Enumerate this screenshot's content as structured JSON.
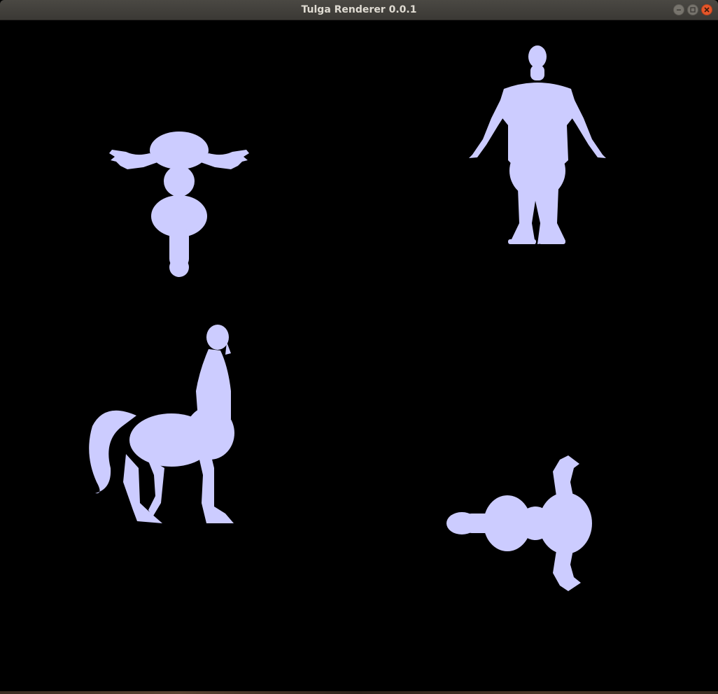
{
  "window": {
    "title": "Tulga Renderer 0.0.1"
  },
  "colors": {
    "titlebar": "#3d3b37",
    "title_text": "#dfdbd2",
    "close_button": "#e5562a",
    "viewport_background": "#000000",
    "silhouette_fill": "#ccccff"
  },
  "icons": {
    "minimize": "minimize-icon",
    "maximize": "maximize-icon",
    "close": "close-icon"
  },
  "viewport": {
    "objects": [
      "figure-top-left",
      "figure-top-right",
      "figure-bottom-left",
      "figure-bottom-right"
    ]
  }
}
